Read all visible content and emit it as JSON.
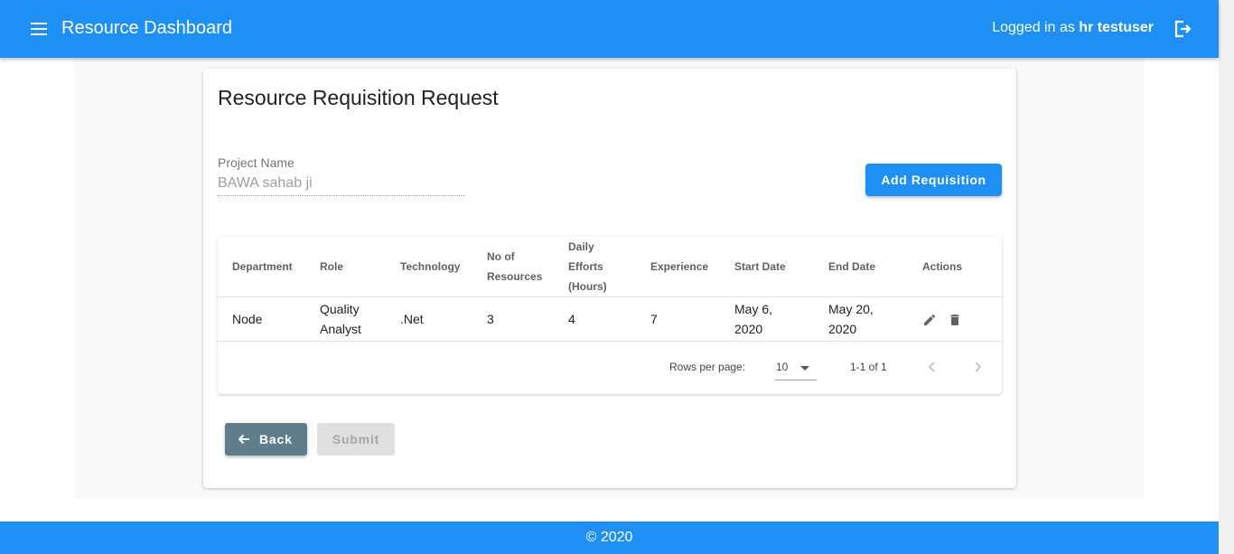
{
  "header": {
    "title": "Resource Dashboard",
    "logged_in_prefix": "Logged in as ",
    "username": "hr testuser"
  },
  "card": {
    "title": "Resource Requisition Request"
  },
  "project": {
    "label": "Project Name",
    "value": "BAWA sahab ji"
  },
  "add_button": "Add Requisition",
  "table": {
    "columns": [
      "Department",
      "Role",
      "Technology",
      "No of Resources",
      "Daily Efforts (Hours)",
      "Experience",
      "Start Date",
      "End Date",
      "Actions"
    ],
    "rows": [
      {
        "department": "Node",
        "role": "Quality Analyst",
        "technology": ".Net",
        "resources": "3",
        "efforts": "4",
        "experience": "7",
        "start": "May 6, 2020",
        "end": "May 20, 2020"
      }
    ]
  },
  "pagination": {
    "rows_label": "Rows per page:",
    "rows_value": "10",
    "range": "1-1 of 1"
  },
  "buttons": {
    "back": "Back",
    "submit": "Submit"
  },
  "footer": {
    "text": "© 2020"
  },
  "colors": {
    "primary": "#1e90f3",
    "back_button": "#607d8b"
  }
}
